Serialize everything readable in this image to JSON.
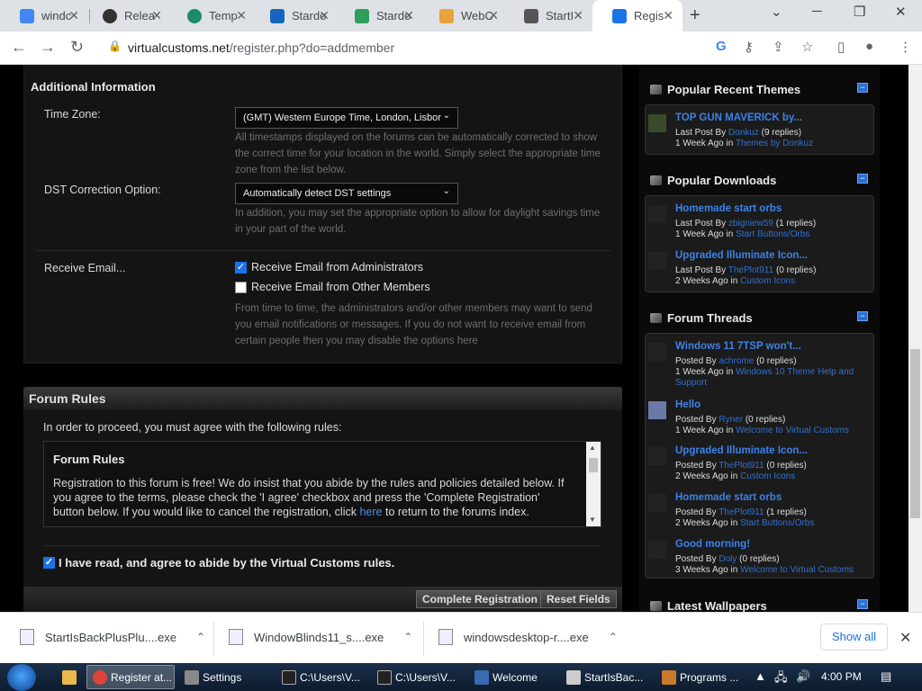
{
  "browser": {
    "tabs": [
      {
        "label": "windc",
        "color": "#4285f4"
      },
      {
        "label": "Relea",
        "color": "#333"
      },
      {
        "label": "Temp",
        "color": "#1c8b6b"
      },
      {
        "label": "Stardo",
        "color": "#1565c0"
      },
      {
        "label": "Stardo",
        "color": "#2e9e5b"
      },
      {
        "label": "WebC",
        "color": "#e8a33d"
      },
      {
        "label": "StartI",
        "color": "#555"
      },
      {
        "label": "Regis",
        "color": "#1a73e8"
      }
    ],
    "url_host": "virtualcustoms.net",
    "url_path": "/register.php?do=addmember"
  },
  "additional": {
    "heading": "Additional Information",
    "timezone_label": "Time Zone:",
    "timezone_value": "(GMT) Western Europe Time, London, Lisbor",
    "timezone_help": "All timestamps displayed on the forums can be automatically corrected to show the correct time for your location in the world. Simply select the appropriate time zone from the list below.",
    "dst_label": "DST Correction Option:",
    "dst_value": "Automatically detect DST settings",
    "dst_help": "In addition, you may set the appropriate option to allow for daylight savings time in your part of the world.",
    "email_label": "Receive Email...",
    "email_admin": "Receive Email from Administrators",
    "email_members": "Receive Email from Other Members",
    "email_help": "From time to time, the administrators and/or other members may want to send you email notifications or messages. If you do not want to receive email from certain people then you may disable the options here"
  },
  "rules": {
    "heading": "Forum Rules",
    "intro": "In order to proceed, you must agree with the following rules:",
    "box_title": "Forum Rules",
    "box_text": "Registration to this forum is free! We do insist that you abide by the rules and policies detailed below. If you agree to the terms, please check the 'I agree' checkbox and press the 'Complete Registration' button below. If you would like to cancel the registration, click",
    "box_link": "here",
    "box_text2": "to return to the forums index.",
    "agree": "I have read, and agree to abide by the Virtual Customs rules.",
    "complete": "Complete Registration",
    "reset": "Reset Fields"
  },
  "sidebar": {
    "themes": {
      "title": "Popular Recent Themes",
      "items": [
        {
          "title": "TOP GUN MAVERICK by...",
          "l1a": "Last Post By",
          "l1u": "Donkuz",
          "l1r": "(9 replies)",
          "l2a": "1 Week Ago",
          "l2b": "in",
          "l2c": "Themes by Donkuz"
        }
      ]
    },
    "downloads": {
      "title": "Popular Downloads",
      "items": [
        {
          "title": "Homemade start orbs",
          "l1a": "Last Post By",
          "l1u": "zbigniew59",
          "l1r": "(1 replies)",
          "l2a": "1 Week Ago",
          "l2b": "in",
          "l2c": "Start Buttons/Orbs"
        },
        {
          "title": "Upgraded Illuminate Icon...",
          "l1a": "Last Post By",
          "l1u": "ThePlot911",
          "l1r": "(0 replies)",
          "l2a": "2 Weeks Ago",
          "l2b": "in",
          "l2c": "Custom Icons"
        }
      ]
    },
    "threads": {
      "title": "Forum Threads",
      "items": [
        {
          "title": "Windows 11 7TSP won't...",
          "l1a": "Posted By",
          "l1u": "achrome",
          "l1r": "(0 replies)",
          "l2a": "1 Week Ago",
          "l2b": "in",
          "l2c": "Windows 10 Theme Help and",
          "l3": "Support"
        },
        {
          "title": "Hello",
          "l1a": "Posted By",
          "l1u": "Ryner",
          "l1r": "(0 replies)",
          "l2a": "1 Week Ago",
          "l2b": "in",
          "l2c": "Welcome to Virtual Customs"
        },
        {
          "title": "Upgraded Illuminate Icon...",
          "l1a": "Posted By",
          "l1u": "ThePlot911",
          "l1r": "(0 replies)",
          "l2a": "2 Weeks Ago",
          "l2b": "in",
          "l2c": "Custom Icons"
        },
        {
          "title": "Homemade start orbs",
          "l1a": "Posted By",
          "l1u": "ThePlot911",
          "l1r": "(1 replies)",
          "l2a": "2 Weeks Ago",
          "l2b": "in",
          "l2c": "Start Buttons/Orbs"
        },
        {
          "title": "Good morning!",
          "l1a": "Posted By",
          "l1u": "Doly",
          "l1r": "(0 replies)",
          "l2a": "3 Weeks Ago",
          "l2b": "in",
          "l2c": "Welcome to Virtual Customs"
        }
      ]
    },
    "wallpapers": {
      "title": "Latest Wallpapers"
    }
  },
  "downloads": {
    "items": [
      "StartIsBackPlusPlu....exe",
      "WindowBlinds11_s....exe",
      "windowsdesktop-r....exe"
    ],
    "show_all": "Show all"
  },
  "taskbar": {
    "items": [
      "Register at...",
      "Settings",
      "C:\\Users\\V...",
      "C:\\Users\\V...",
      "Welcome",
      "StartIsBac...",
      "Programs ..."
    ],
    "clock": "4:00 PM"
  }
}
